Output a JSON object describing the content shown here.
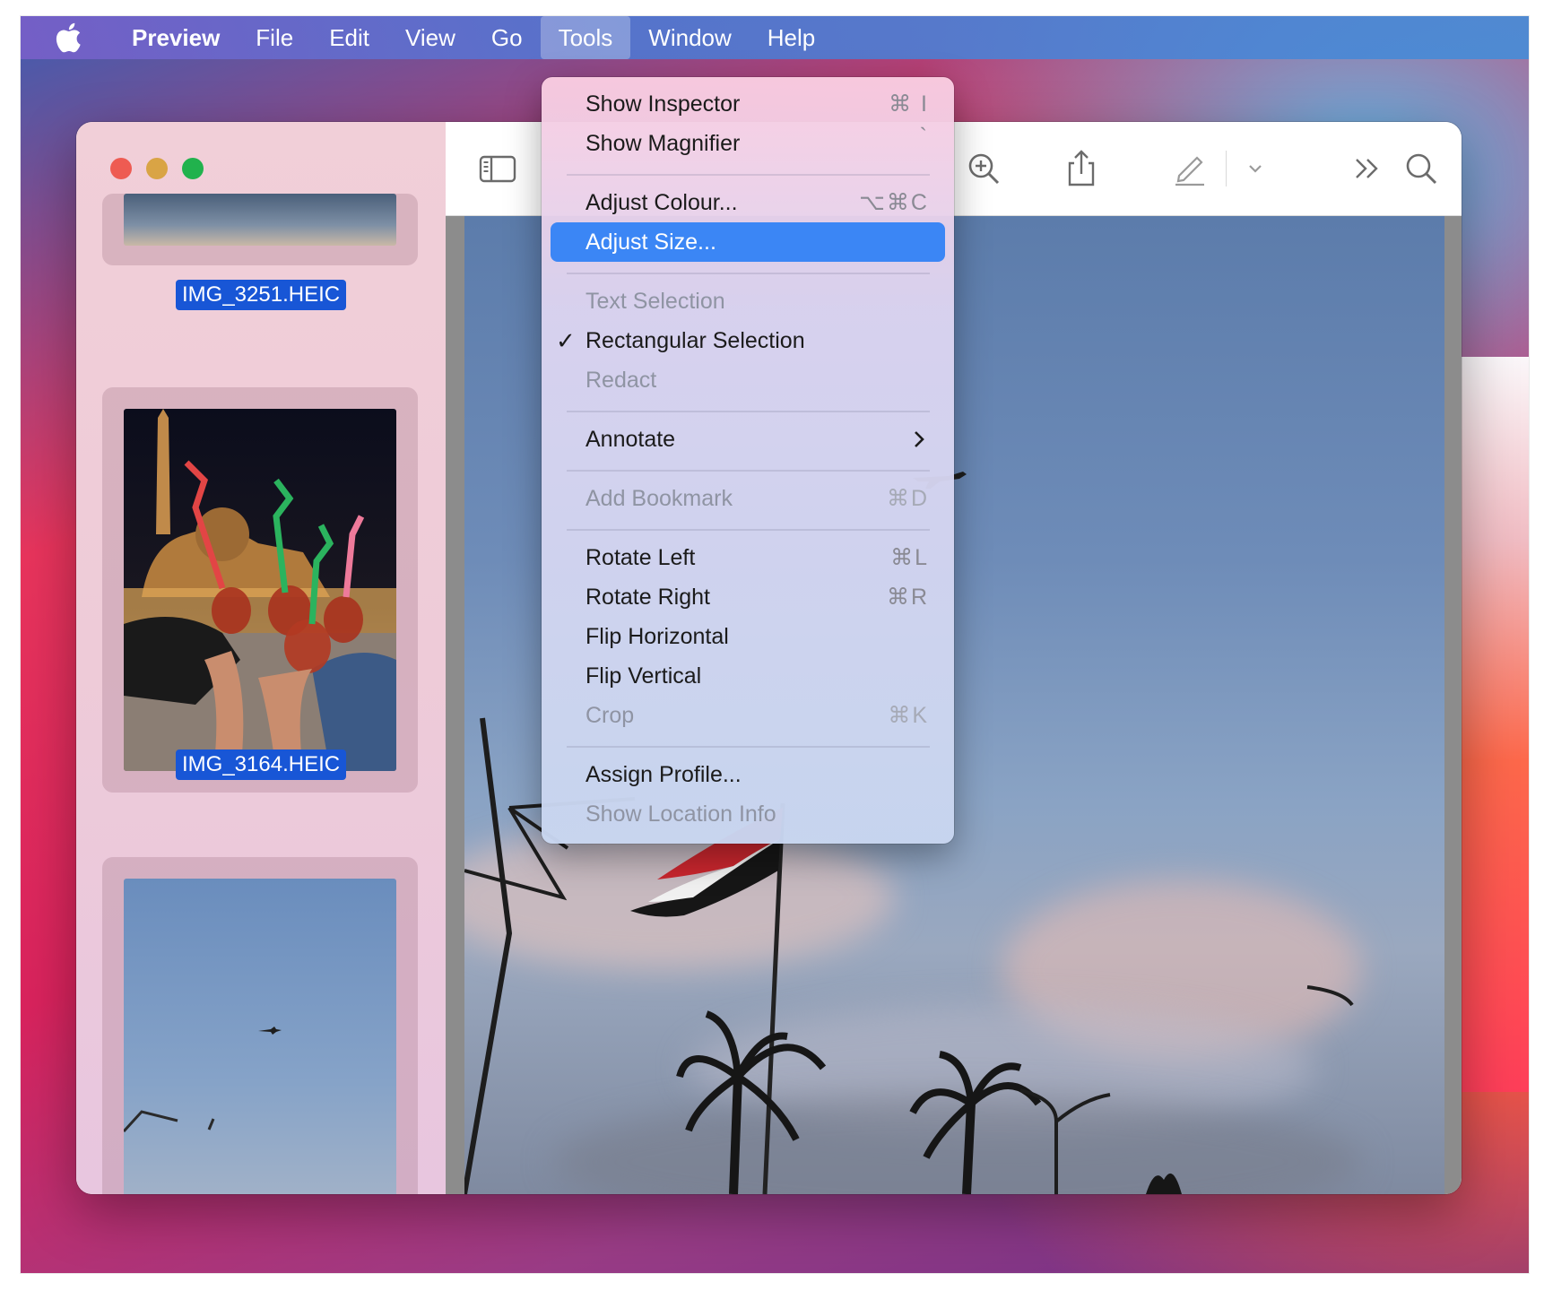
{
  "menubar": {
    "app_name": "Preview",
    "items": [
      "File",
      "Edit",
      "View",
      "Go",
      "Tools",
      "Window",
      "Help"
    ]
  },
  "sidebar": {
    "thumbnails": [
      {
        "filename": "IMG_3251.HEIC"
      },
      {
        "filename": "IMG_3164.HEIC"
      },
      {
        "filename": ""
      }
    ]
  },
  "tools_menu": {
    "items": [
      {
        "label": "Show Inspector",
        "shortcut": "⌘ I",
        "enabled": true
      },
      {
        "label": "Show Magnifier",
        "shortcut": "`",
        "enabled": true
      },
      {
        "label": "Adjust Colour...",
        "shortcut": "⌥⌘C",
        "enabled": true
      },
      {
        "label": "Adjust Size...",
        "shortcut": "",
        "enabled": true,
        "highlighted": true
      },
      {
        "label": "Text Selection",
        "shortcut": "",
        "enabled": false
      },
      {
        "label": "Rectangular Selection",
        "shortcut": "",
        "enabled": true,
        "checked": true
      },
      {
        "label": "Redact",
        "shortcut": "",
        "enabled": false
      },
      {
        "label": "Annotate",
        "shortcut": "",
        "enabled": true,
        "submenu": true
      },
      {
        "label": "Add Bookmark",
        "shortcut": "⌘D",
        "enabled": false
      },
      {
        "label": "Rotate Left",
        "shortcut": "⌘L",
        "enabled": true
      },
      {
        "label": "Rotate Right",
        "shortcut": "⌘R",
        "enabled": true
      },
      {
        "label": "Flip Horizontal",
        "shortcut": "",
        "enabled": true
      },
      {
        "label": "Flip Vertical",
        "shortcut": "",
        "enabled": true
      },
      {
        "label": "Crop",
        "shortcut": "⌘K",
        "enabled": false
      },
      {
        "label": "Assign Profile...",
        "shortcut": "",
        "enabled": true
      },
      {
        "label": "Show Location Info",
        "shortcut": "",
        "enabled": false
      }
    ],
    "check_glyph": "✓"
  },
  "colors": {
    "selection_blue": "#3b86f5",
    "label_blue": "#1856d6",
    "traffic_red": "#ee5b52",
    "traffic_yellow": "#d9a445",
    "traffic_green": "#21b24d"
  }
}
